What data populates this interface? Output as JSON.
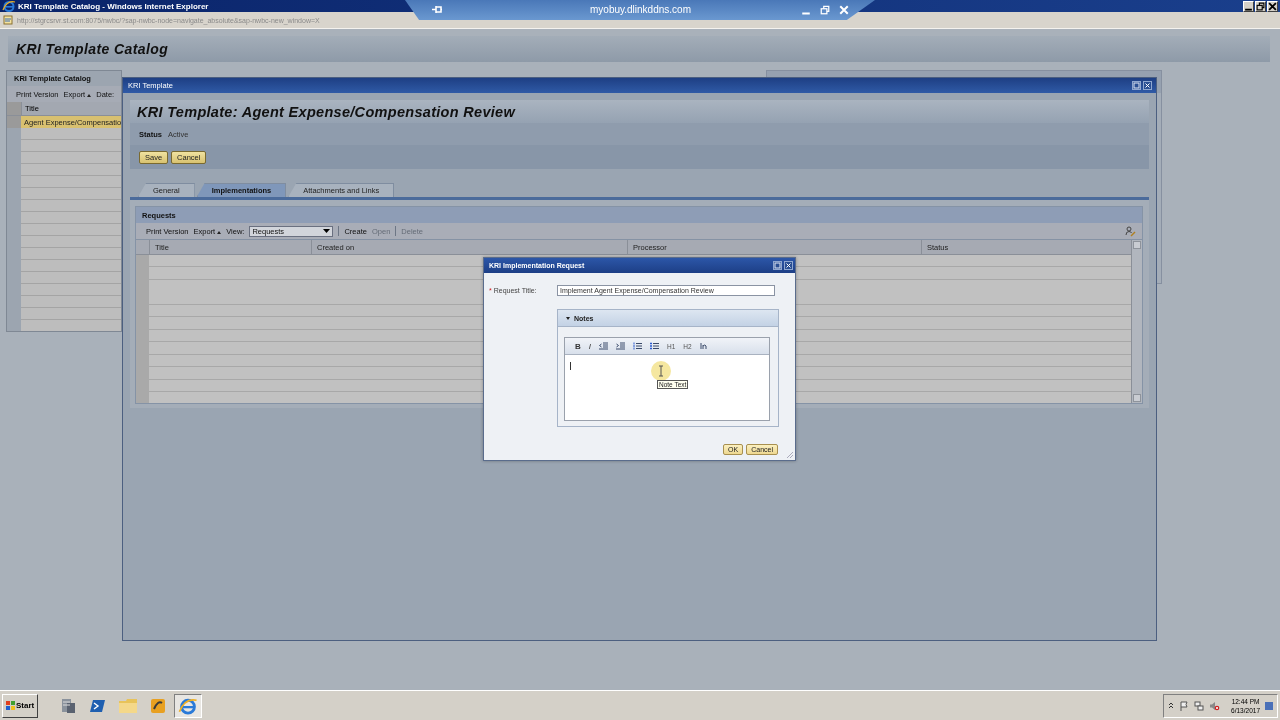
{
  "browser": {
    "title": "KRI Template Catalog - Windows Internet Explorer",
    "address": "http://stgrcsrvr.st.com:8075/nwbc/?sap-nwbc-node=navigate_absolute&sap-nwbc-new_window=X"
  },
  "remote_bar": {
    "host": "myobuy.dlinkddns.com"
  },
  "page": {
    "title": "KRI Template Catalog"
  },
  "catalog": {
    "title": "KRI Template Catalog",
    "toolbar": [
      {
        "kind": "button",
        "label": "Print Version",
        "disabled": false
      },
      {
        "kind": "menu",
        "label": "Export",
        "disabled": false
      },
      {
        "kind": "label",
        "label": "Date:"
      }
    ],
    "columns": [
      "Title"
    ],
    "rows": [
      {
        "title": "Agent Expense/Compensatio",
        "selected": true
      }
    ]
  },
  "template_dialog": {
    "title": "KRI Template",
    "heading": "KRI Template: Agent Expense/Compensation Review",
    "status_label": "Status",
    "status_value": "Active",
    "buttons": [
      "Save",
      "Cancel"
    ],
    "tabs": [
      {
        "label": "General",
        "selected": false
      },
      {
        "label": "Implementations",
        "selected": true
      },
      {
        "label": "Attachments and Links",
        "selected": false
      }
    ],
    "requests": {
      "title": "Requests",
      "toolbar": [
        {
          "kind": "button",
          "label": "Print Version",
          "disabled": false
        },
        {
          "kind": "menu",
          "label": "Export",
          "disabled": false
        },
        {
          "kind": "label",
          "label": "View:"
        },
        {
          "kind": "select",
          "label": "Requests"
        },
        {
          "kind": "separator"
        },
        {
          "kind": "button",
          "label": "Create",
          "disabled": false
        },
        {
          "kind": "button",
          "label": "Open",
          "disabled": true
        },
        {
          "kind": "separator"
        },
        {
          "kind": "button",
          "label": "Delete",
          "disabled": true
        }
      ],
      "columns": [
        "Title",
        "Created on",
        "Processor",
        "Status"
      ]
    }
  },
  "request_dialog": {
    "title": "KRI Implementation Request",
    "field": {
      "label": "Request Title:",
      "required": true,
      "required_mark": "*",
      "value": "Implement Agent Expense/Compensation Review"
    },
    "notes": {
      "title": "Notes",
      "expanded": true,
      "toolbar": [
        {
          "kind": "bold",
          "label": "B"
        },
        {
          "kind": "italic",
          "label": "I"
        },
        {
          "kind": "outdent"
        },
        {
          "kind": "indent"
        },
        {
          "kind": "numbered"
        },
        {
          "kind": "bulleted"
        },
        {
          "kind": "heading",
          "label": "H1"
        },
        {
          "kind": "heading",
          "label": "H2"
        },
        {
          "kind": "clear"
        }
      ],
      "tooltip": "Note Text"
    },
    "buttons": [
      "OK",
      "Cancel"
    ]
  },
  "taskbar": {
    "start": "Start",
    "apps": [
      {
        "kind": "server",
        "active": false
      },
      {
        "kind": "powershell",
        "active": false
      },
      {
        "kind": "folder",
        "active": false
      },
      {
        "kind": "app",
        "active": false
      },
      {
        "kind": "ie",
        "active": true
      }
    ],
    "time": "12:44 PM",
    "date": "6/13/2017"
  }
}
